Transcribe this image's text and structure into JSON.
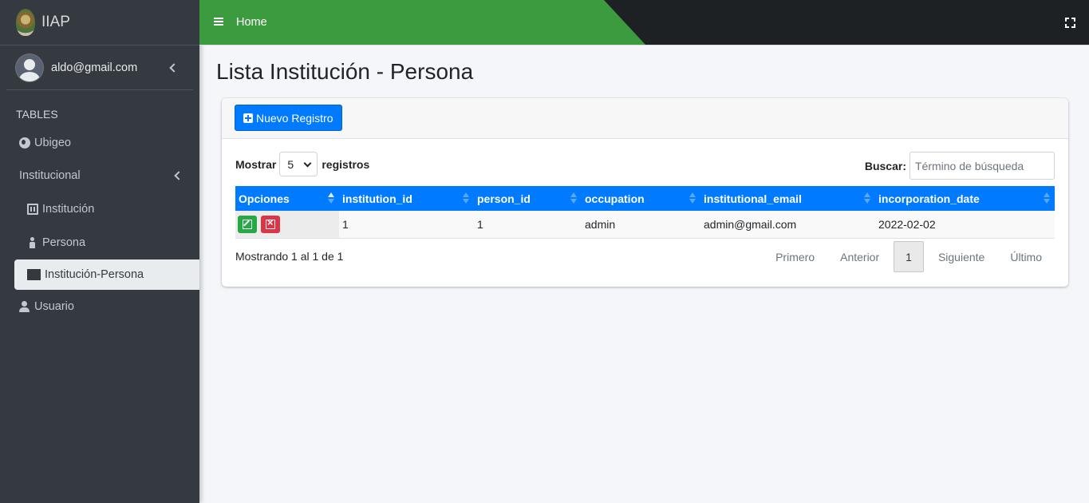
{
  "brand": {
    "name": "IIAP"
  },
  "user": {
    "email": "aldo@gmail.com"
  },
  "sidebar": {
    "header": "TABLES",
    "items": [
      {
        "label": "Ubigeo",
        "icon": "globe-icon"
      },
      {
        "label": "Institucional",
        "icon": "none"
      },
      {
        "label": "Institución",
        "icon": "building-icon"
      },
      {
        "label": "Persona",
        "icon": "person-icon"
      },
      {
        "label": "Institución-Persona",
        "icon": "building-user-icon"
      },
      {
        "label": "Usuario",
        "icon": "user-icon"
      }
    ]
  },
  "topbar": {
    "home": "Home",
    "accent": "#3c9a3f"
  },
  "page": {
    "title": "Lista Institución - Persona"
  },
  "toolbar": {
    "new_label": "Nuevo Registro"
  },
  "table_controls": {
    "show_label": "Mostrar",
    "show_value": "5",
    "records_label": "registros",
    "search_label": "Buscar:",
    "search_placeholder": "Término de búsqueda"
  },
  "table": {
    "columns": [
      "Opciones",
      "institution_id",
      "person_id",
      "occupation",
      "institutional_email",
      "incorporation_date"
    ],
    "rows": [
      [
        "1",
        "1",
        "admin",
        "admin@gmail.com",
        "2022-02-02"
      ]
    ]
  },
  "footer": {
    "info": "Mostrando 1 al 1 de 1",
    "first": "Primero",
    "prev": "Anterior",
    "page": "1",
    "next": "Siguiente",
    "last": "Último"
  }
}
